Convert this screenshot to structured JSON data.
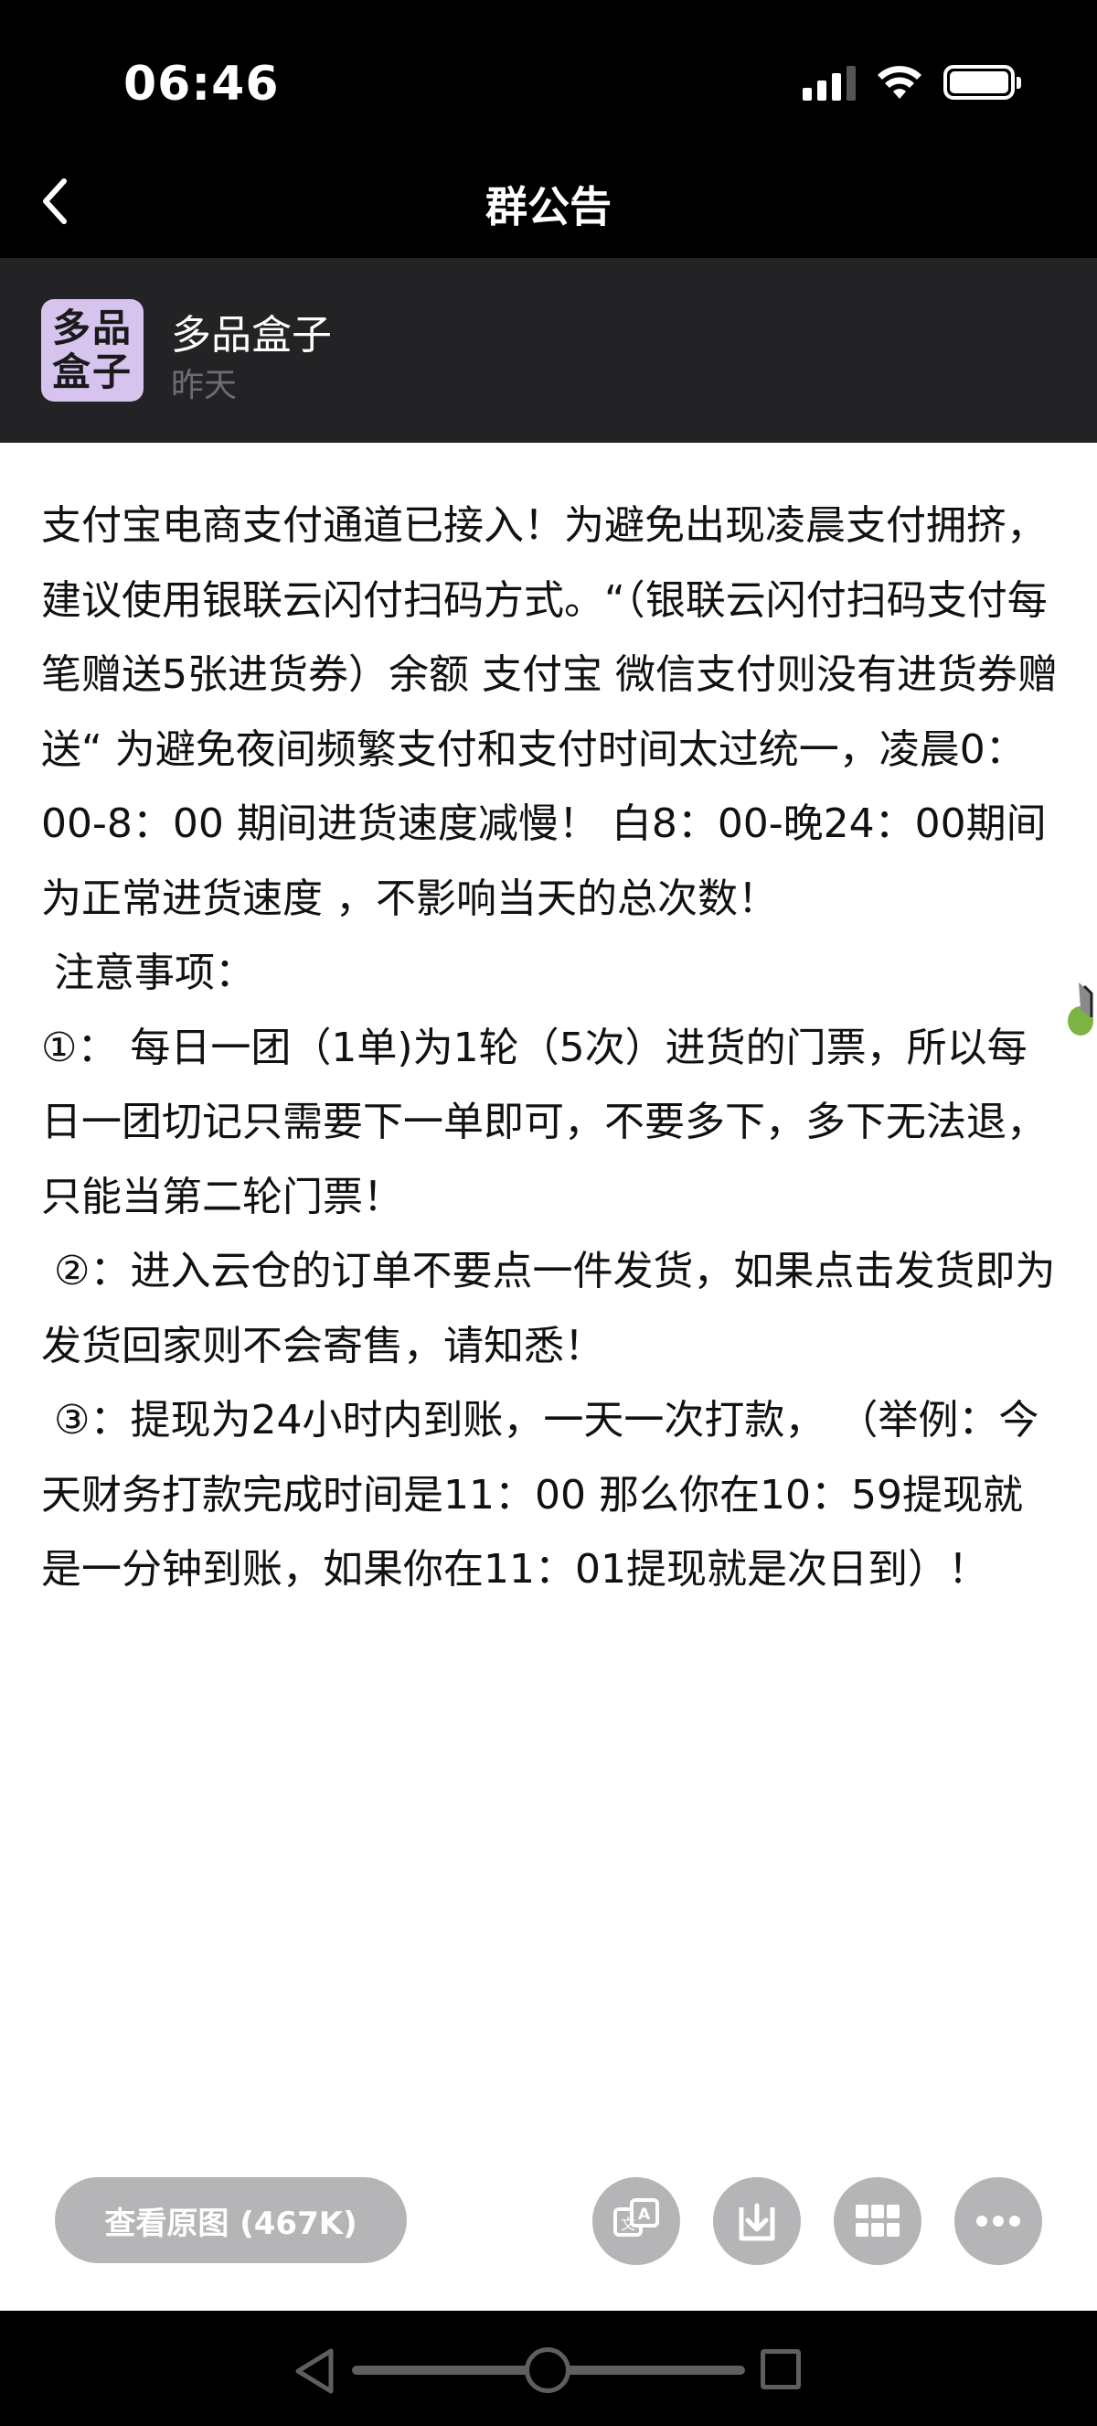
{
  "status_bar": {
    "time": "06:46"
  },
  "nav": {
    "title": "群公告"
  },
  "sender": {
    "avatar_text_line1": "多品",
    "avatar_text_line2": "盒子",
    "name": "多品盒子",
    "time": "昨天"
  },
  "notice": {
    "paragraphs": [
      "支付宝电商支付通道已接入！为避免出现凌晨支付拥挤，建议使用银联云闪付扫码方式。“（银联云闪付扫码支付每笔赠送5张进货券）余额 支付宝 微信支付则没有进货券赠送“ 为避免夜间频繁支付和支付时间太过统一，凌晨0：00-8：00 期间进货速度减慢！ 白8：00-晚24：00期间为正常进货速度 ，不影响当天的总次数！",
      " 注意事项：",
      "①： 每日一团（1单)为1轮（5次）进货的门票，所以每日一团切记只需要下一单即可，不要多下，多下无法退，只能当第二轮门票！",
      " ②：进入云仓的订单不要点一件发货，如果点击发货即为发货回家则不会寄售，请知悉！",
      " ③：提现为24小时内到账，一天一次打款， （举例：今天财务打款完成时间是11：00 那么你在10：59提现就是一分钟到账，如果你在11：01提现就是次日到）！"
    ]
  },
  "actions": {
    "view_original_label": "查看原图 (467K)",
    "icons": [
      "translate-icon",
      "download-icon",
      "grid-icon",
      "more-icon"
    ]
  },
  "colors": {
    "background_dark": "#000000",
    "header_bg": "#232325",
    "content_bg": "#ffffff",
    "button_gray": "#b5b5b7",
    "avatar_bg": "#d7c4ee"
  }
}
